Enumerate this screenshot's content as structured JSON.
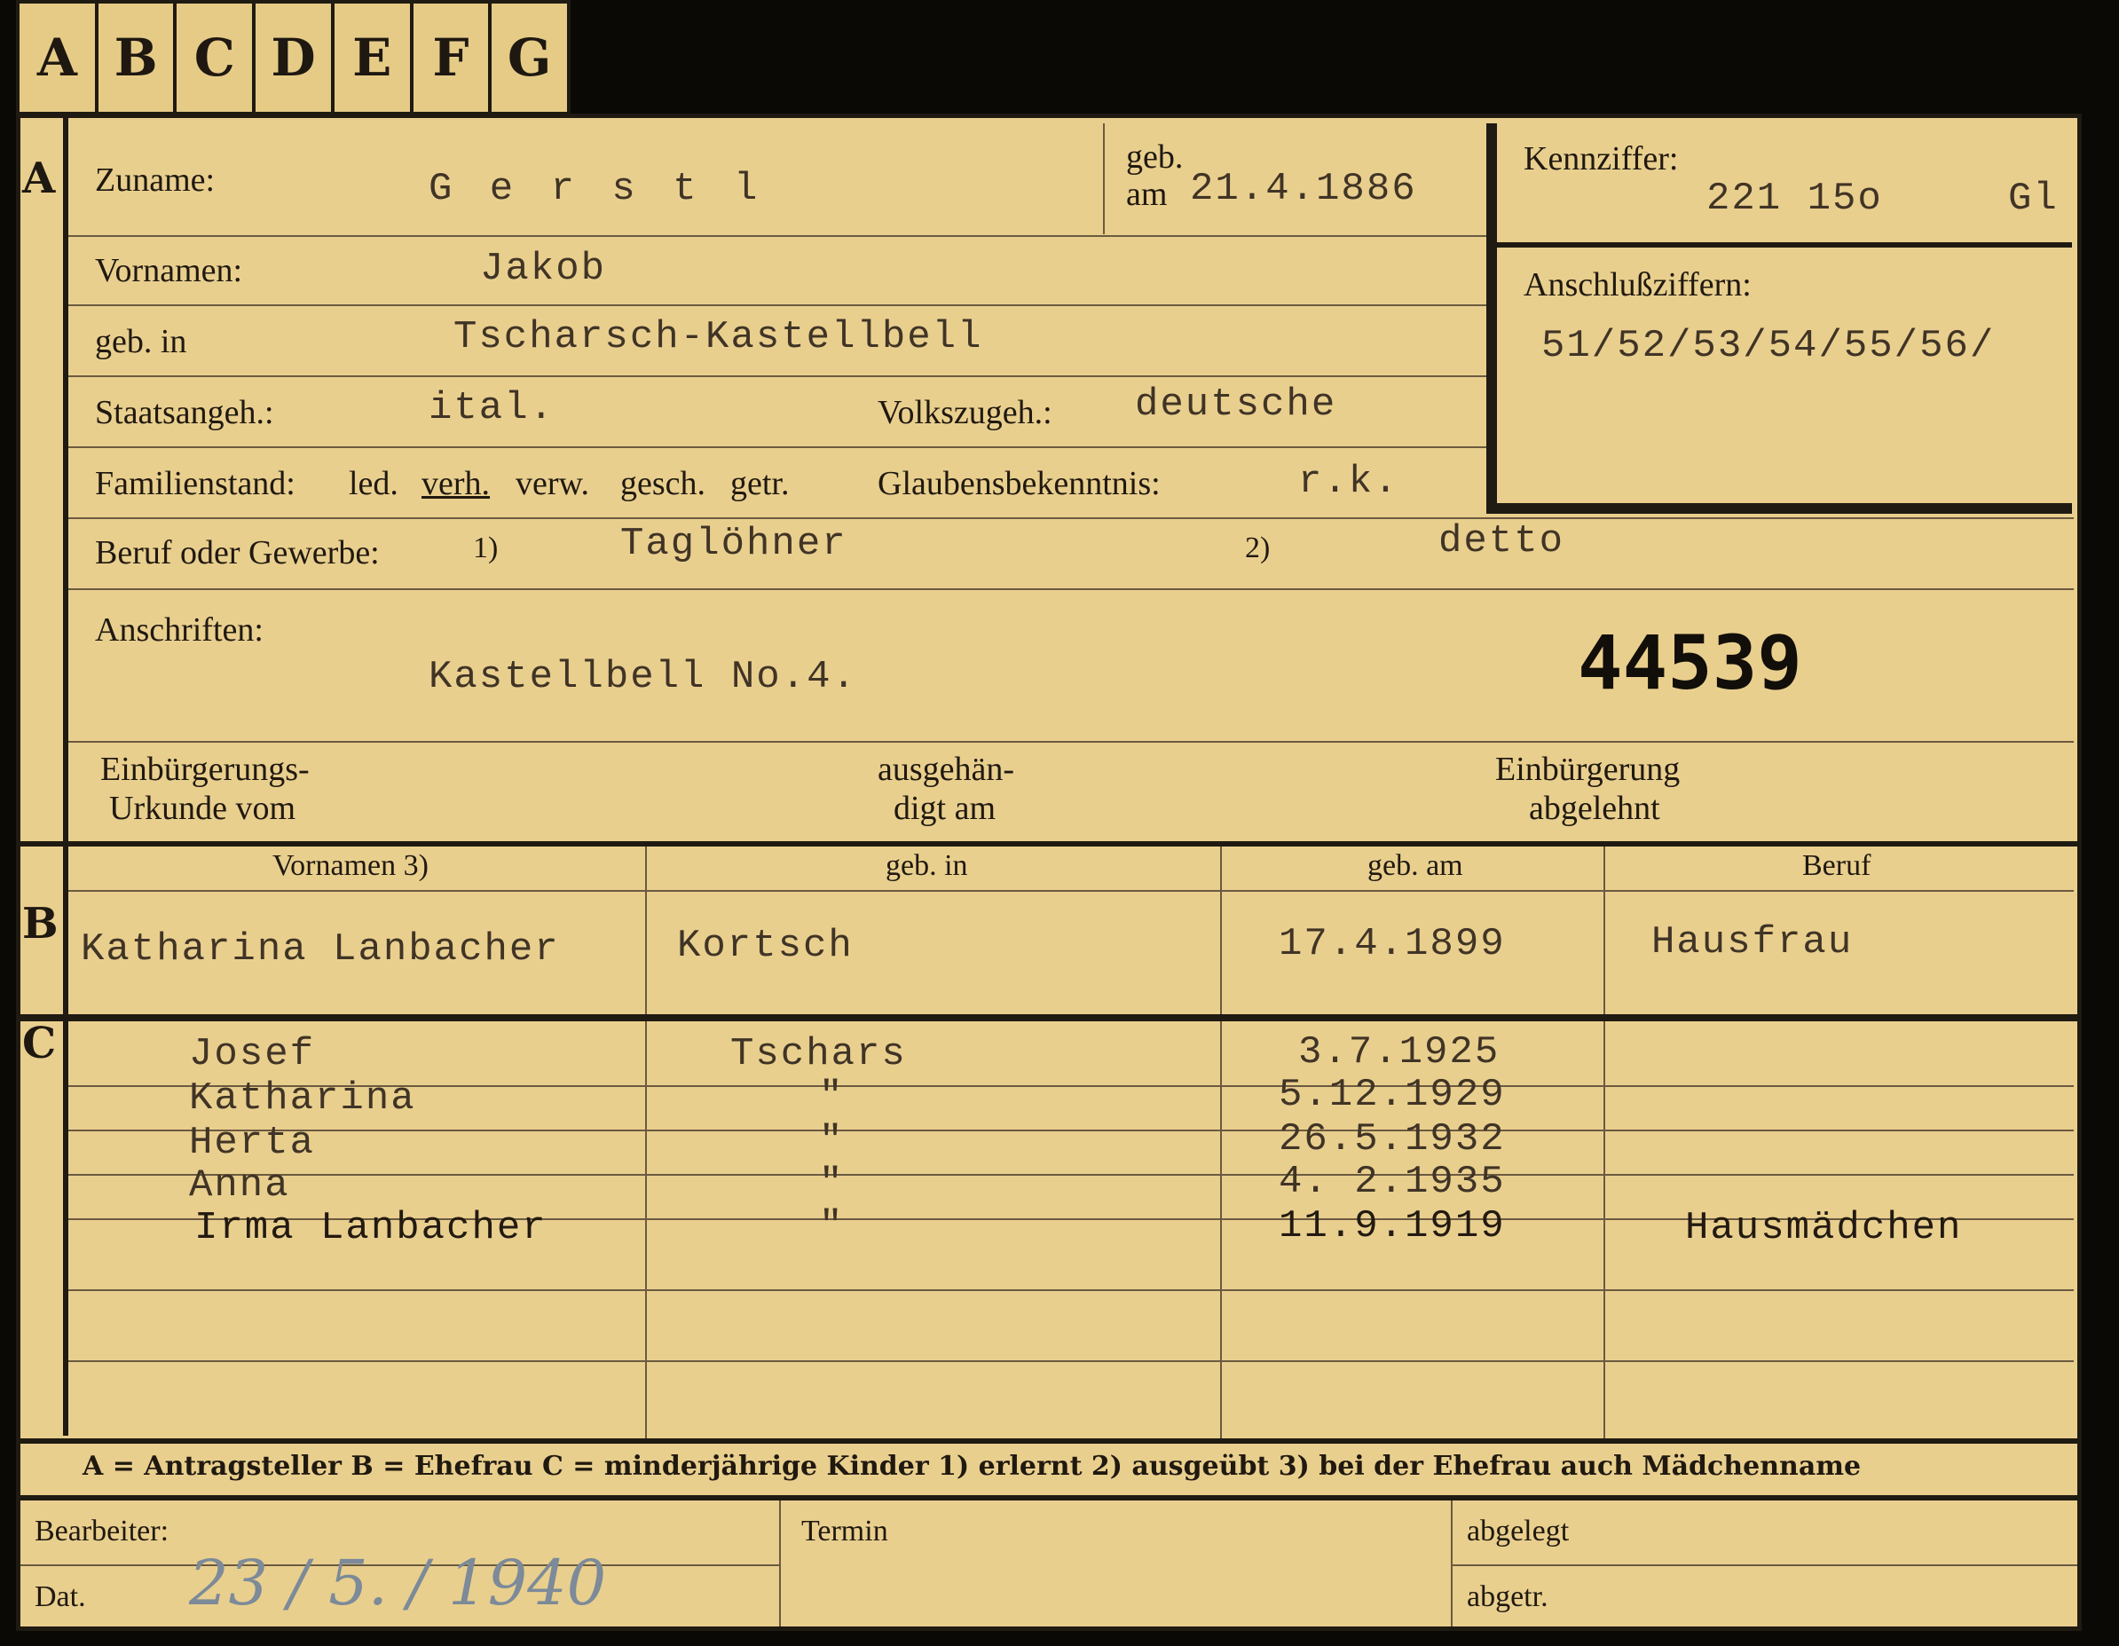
{
  "tabs": [
    "A",
    "B",
    "C",
    "D",
    "E",
    "F",
    "G"
  ],
  "section_letters": {
    "a": "A",
    "b": "B",
    "c": "C"
  },
  "applicant": {
    "surname_label": "Zuname:",
    "surname": "G e r s t l",
    "born_on_label_1": "geb.",
    "born_on_label_2": "am",
    "born_on": "21.4.1886",
    "first_names_label": "Vornamen:",
    "first_names": "Jakob",
    "born_in_label": "geb. in",
    "born_in": "Tscharsch-Kastellbell",
    "citizenship_label": "Staatsangeh.:",
    "citizenship": "ital.",
    "ethnicity_label": "Volkszugeh.:",
    "ethnicity": "deutsche",
    "marital_label": "Familienstand:",
    "marital_options": [
      "led.",
      "verh.",
      "verw.",
      "gesch.",
      "getr."
    ],
    "religion_label": "Glaubensbekenntnis:",
    "religion": "r.k.",
    "profession_label": "Beruf oder Gewerbe:",
    "profession_note_1": "1)",
    "profession_learned": "Taglöhner",
    "profession_note_2": "2)",
    "profession_practiced": "detto",
    "addresses_label": "Anschriften:",
    "address": "Kastellbell No.4.",
    "case_number": "44539",
    "naturalization_cert_1": "Einbürgerungs-",
    "naturalization_cert_2": "Urkunde vom",
    "handed_1": "ausgehän-",
    "handed_2": "digt am",
    "refused_1": "Einbürgerung",
    "refused_2": "abgelehnt"
  },
  "ref_box": {
    "code_label": "Kennziffer:",
    "code": "221 15o",
    "code_suffix": "Gl",
    "linked_label": "Anschlußziffern:",
    "linked": "51/52/53/54/55/56/"
  },
  "spouse": {
    "headers": [
      "Vornamen 3)",
      "geb. in",
      "geb. am",
      "Beruf"
    ],
    "name": "Katharina Lanbacher",
    "born_in": "Kortsch",
    "born_on": "17.4.1899",
    "profession": "Hausfrau"
  },
  "children": [
    {
      "name": "Josef",
      "born_in": "Tschars",
      "born_on": "3.7.1925",
      "profession": ""
    },
    {
      "name": "Katharina",
      "born_in": "\"",
      "born_on": "5.12.1929",
      "profession": ""
    },
    {
      "name": "Herta",
      "born_in": "\"",
      "born_on": "26.5.1932",
      "profession": ""
    },
    {
      "name": "Anna",
      "born_in": "\"",
      "born_on": "4. 2.1935",
      "profession": ""
    },
    {
      "name": "Irma Lanbacher",
      "born_in": "\"",
      "born_on": "11.9.1919",
      "profession": "Hausmädchen"
    }
  ],
  "legend": "A = Antragsteller   B = Ehefrau   C = minderjährige Kinder   1) erlernt   2) ausgeübt   3) bei der Ehefrau auch Mädchenname",
  "footer": {
    "clerk_label": "Bearbeiter:",
    "date_label": "Dat.",
    "date_handwritten": "23 / 5. / 1940",
    "term_label": "Termin",
    "filed_label": "abgelegt",
    "sent_label": "abgetr."
  }
}
